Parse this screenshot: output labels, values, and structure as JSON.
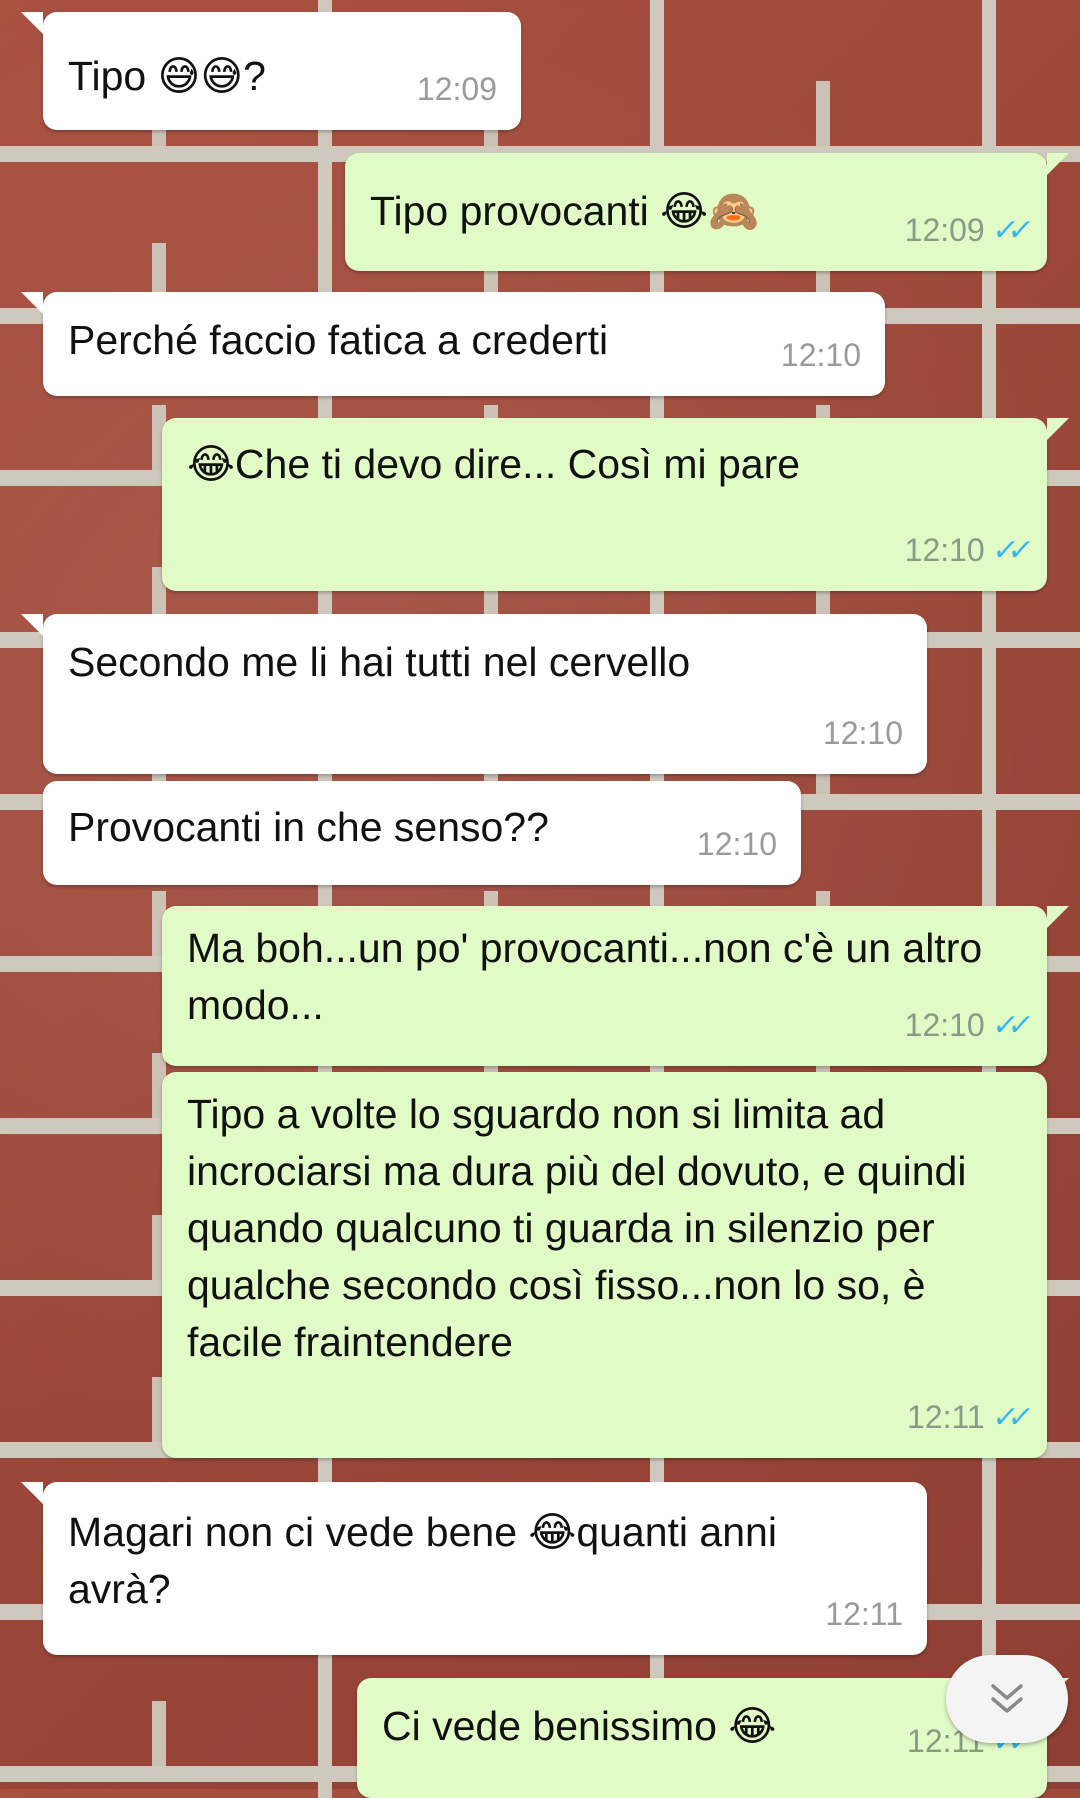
{
  "messages": [
    {
      "id": 1,
      "dir": "in",
      "text": "Tipo 😅😅?",
      "time": "12:09"
    },
    {
      "id": 2,
      "dir": "out",
      "text": "Tipo provocanti 😂🙈",
      "time": "12:09",
      "status": "read"
    },
    {
      "id": 3,
      "dir": "in",
      "text": "Perché faccio fatica a crederti",
      "time": "12:10"
    },
    {
      "id": 4,
      "dir": "out",
      "text": "😂Che ti devo dire... Così mi pare",
      "time": "12:10",
      "status": "read"
    },
    {
      "id": 5,
      "dir": "in",
      "text": "Secondo me li hai tutti nel cervello",
      "time": "12:10"
    },
    {
      "id": 6,
      "dir": "in",
      "text": "Provocanti in che senso??",
      "time": "12:10"
    },
    {
      "id": 7,
      "dir": "out",
      "text": "Ma boh...un po' provocanti...non c'è un altro modo...",
      "time": "12:10",
      "status": "read"
    },
    {
      "id": 8,
      "dir": "out",
      "text": "Tipo a volte lo sguardo non si limita ad incrociarsi ma dura più del dovuto, e quindi quando qualcuno ti guarda in silenzio per qualche secondo così fisso...non lo so, è facile fraintendere",
      "time": "12:11",
      "status": "read"
    },
    {
      "id": 9,
      "dir": "in",
      "text": "Magari non ci vede bene 😂quanti anni avrà?",
      "time": "12:11"
    },
    {
      "id": 10,
      "dir": "out",
      "text": "Ci vede benissimo 😂",
      "time": "12:11",
      "status": "read"
    }
  ],
  "read_tick_color": "#34b7f1",
  "incoming_bubble_color": "#ffffff",
  "outgoing_bubble_color": "#e1fbc7",
  "scroll_button": {
    "icon": "double-chevron-down-icon"
  }
}
